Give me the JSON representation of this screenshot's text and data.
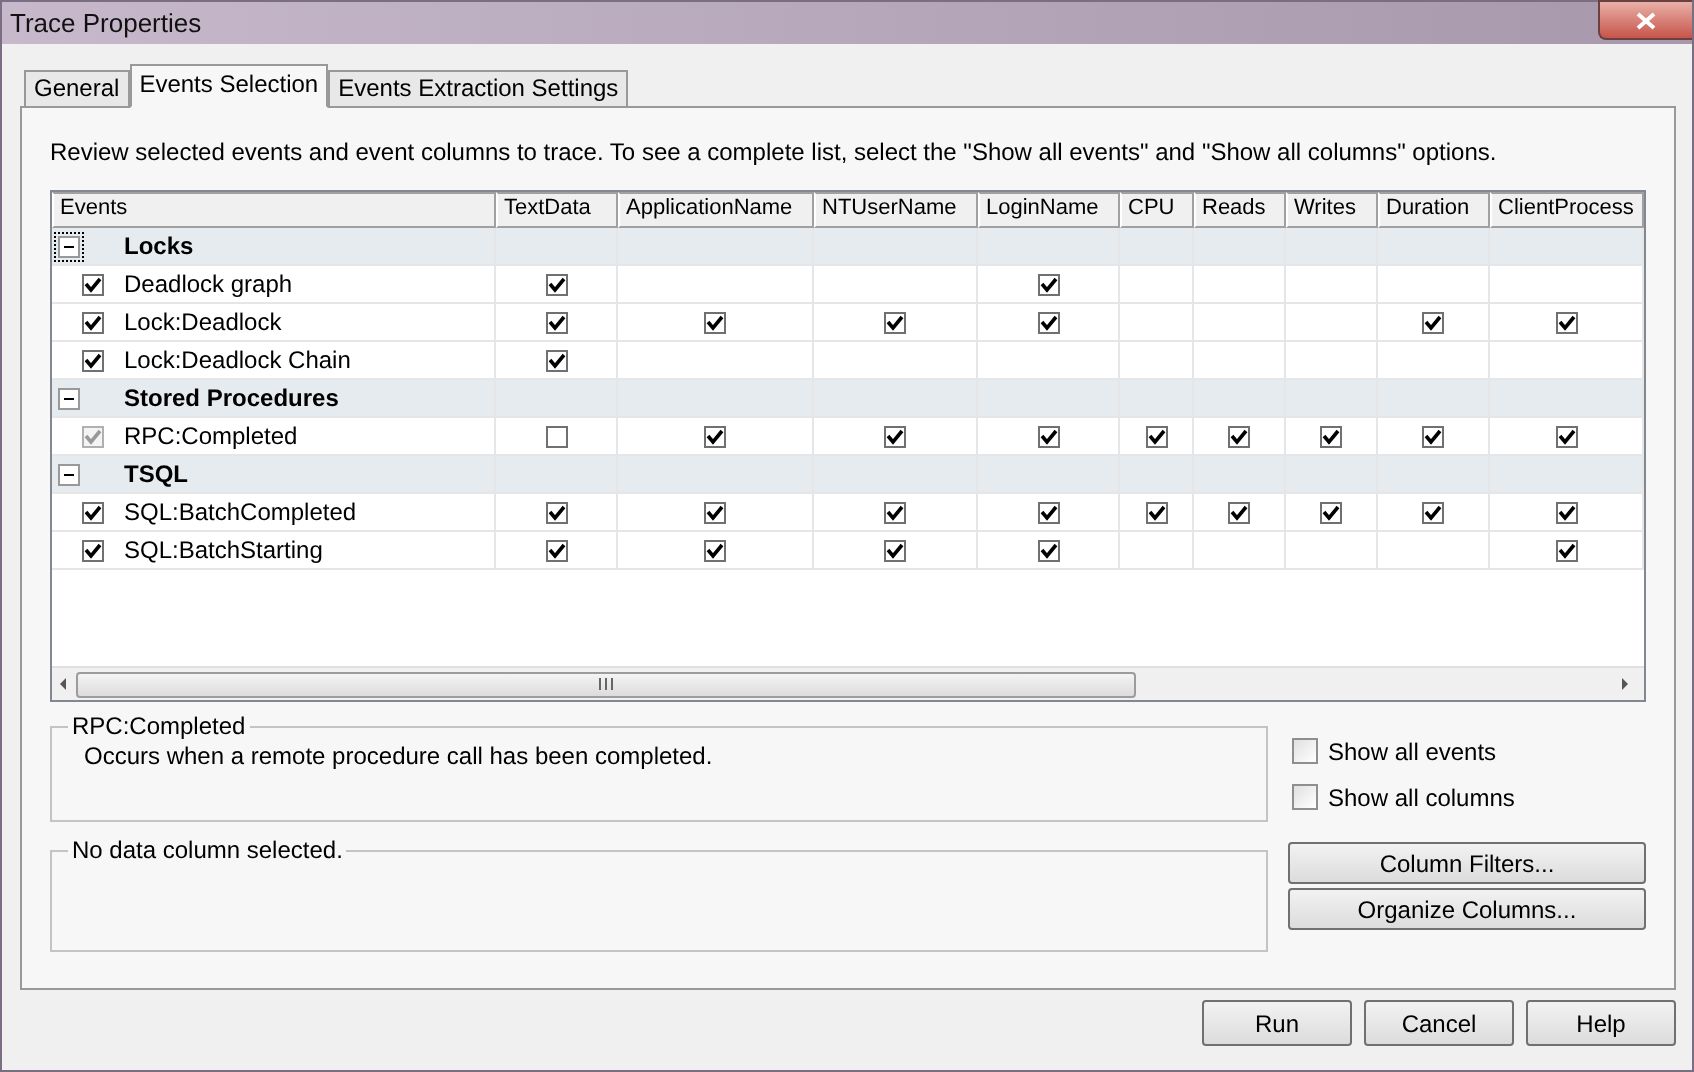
{
  "window": {
    "title": "Trace Properties"
  },
  "tabs": [
    {
      "label": "General",
      "selected": false
    },
    {
      "label": "Events Selection",
      "selected": true
    },
    {
      "label": "Events Extraction Settings",
      "selected": false
    }
  ],
  "instructions": "Review selected events and event columns to trace. To see a complete list, select the \"Show all events\" and \"Show all columns\" options.",
  "grid": {
    "columns": [
      "Events",
      "TextData",
      "ApplicationName",
      "NTUserName",
      "LoginName",
      "CPU",
      "Reads",
      "Writes",
      "Duration",
      "ClientProcess"
    ],
    "rows": [
      {
        "kind": "category",
        "label": "Locks",
        "expanded": true,
        "focused": true
      },
      {
        "kind": "event",
        "label": "Deadlock graph",
        "checked": true,
        "disabled": false,
        "cells": [
          true,
          null,
          null,
          true,
          null,
          null,
          null,
          null,
          null
        ]
      },
      {
        "kind": "event",
        "label": "Lock:Deadlock",
        "checked": true,
        "disabled": false,
        "cells": [
          true,
          true,
          true,
          true,
          null,
          null,
          null,
          true,
          true
        ]
      },
      {
        "kind": "event",
        "label": "Lock:Deadlock Chain",
        "checked": true,
        "disabled": false,
        "cells": [
          true,
          null,
          null,
          null,
          null,
          null,
          null,
          null,
          null
        ]
      },
      {
        "kind": "category",
        "label": "Stored Procedures",
        "expanded": true,
        "focused": false
      },
      {
        "kind": "event",
        "label": "RPC:Completed",
        "checked": true,
        "disabled": true,
        "cells": [
          false,
          true,
          true,
          true,
          true,
          true,
          true,
          true,
          true
        ]
      },
      {
        "kind": "category",
        "label": "TSQL",
        "expanded": true,
        "focused": false
      },
      {
        "kind": "event",
        "label": "SQL:BatchCompleted",
        "checked": true,
        "disabled": false,
        "cells": [
          true,
          true,
          true,
          true,
          true,
          true,
          true,
          true,
          true
        ]
      },
      {
        "kind": "event",
        "label": "SQL:BatchStarting",
        "checked": true,
        "disabled": false,
        "cells": [
          true,
          true,
          true,
          true,
          null,
          null,
          null,
          null,
          true
        ]
      }
    ]
  },
  "event_description": {
    "title": "RPC:Completed",
    "text": "Occurs when a remote procedure call has been completed."
  },
  "column_description": {
    "title": "No data column selected."
  },
  "options": [
    {
      "label": "Show all events",
      "checked": false
    },
    {
      "label": "Show all columns",
      "checked": false
    }
  ],
  "side_buttons": [
    "Column Filters...",
    "Organize Columns..."
  ],
  "buttons": [
    "Run",
    "Cancel",
    "Help"
  ]
}
